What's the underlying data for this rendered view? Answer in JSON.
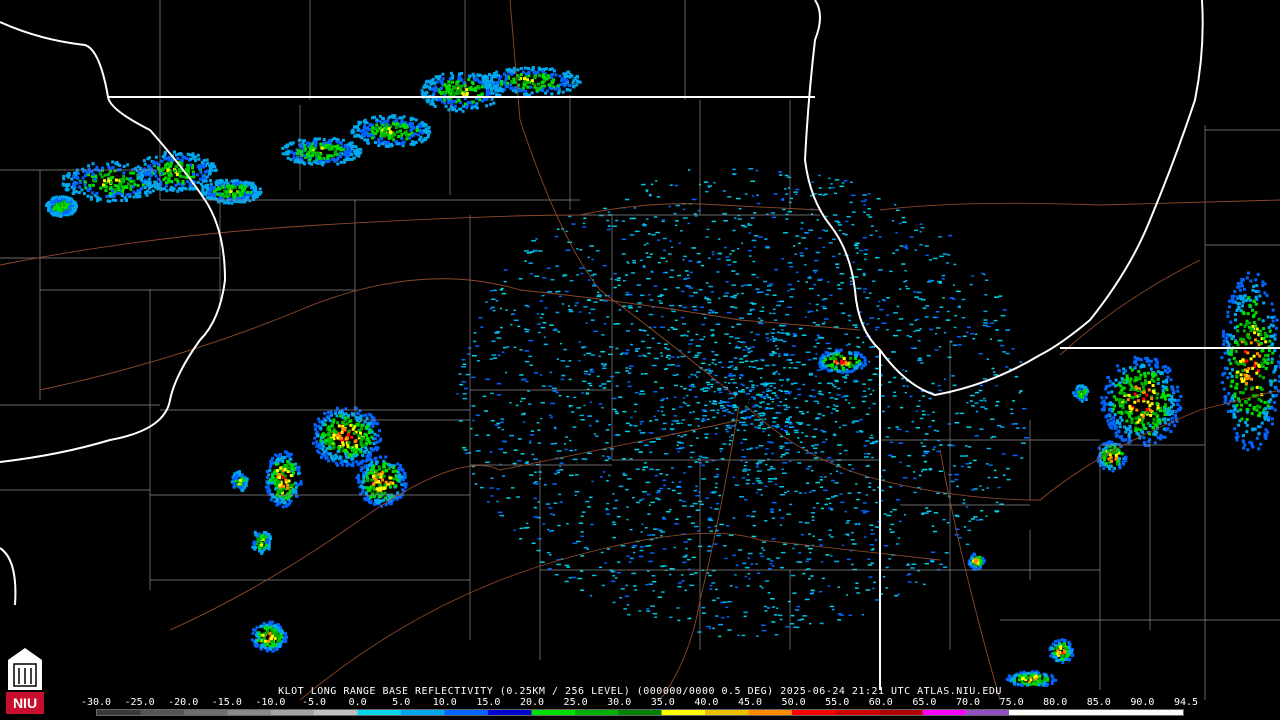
{
  "product_title": "KLOT LONG RANGE BASE REFLECTIVITY (0.25KM / 256 LEVEL) (000000/0000 0.5 DEG) 2025-06-24 21:21 UTC  ATLAS.NIU.EDU",
  "scale_ticks": [
    "-30.0",
    "-25.0",
    "-20.0",
    "-15.0",
    "-10.0",
    "-5.0",
    "0.0",
    "5.0",
    "10.0",
    "15.0",
    "20.0",
    "25.0",
    "30.0",
    "35.0",
    "40.0",
    "45.0",
    "50.0",
    "55.0",
    "60.0",
    "65.0",
    "70.0",
    "75.0",
    "80.0",
    "85.0",
    "90.0",
    "94.5"
  ],
  "scale_colors": [
    "#3a3a3a",
    "#555555",
    "#6e6e6e",
    "#8a8a8a",
    "#a4a4a4",
    "#c0c0c0",
    "#00d8e8",
    "#00a8f0",
    "#0064ff",
    "#0000d0",
    "#00e000",
    "#00b000",
    "#008000",
    "#ffff00",
    "#e8c000",
    "#ff8c00",
    "#ff0000",
    "#d00000",
    "#b00000",
    "#ff00ff",
    "#9050c0",
    "#ffffff",
    "#ffffff",
    "#ffffff",
    "#ffffff"
  ],
  "logo_text": "NIU",
  "colors": {
    "state_border": "#ffffff",
    "county_border": "#8a8a8a",
    "highway": "#8b4a2a",
    "radar_site": "#000000"
  }
}
